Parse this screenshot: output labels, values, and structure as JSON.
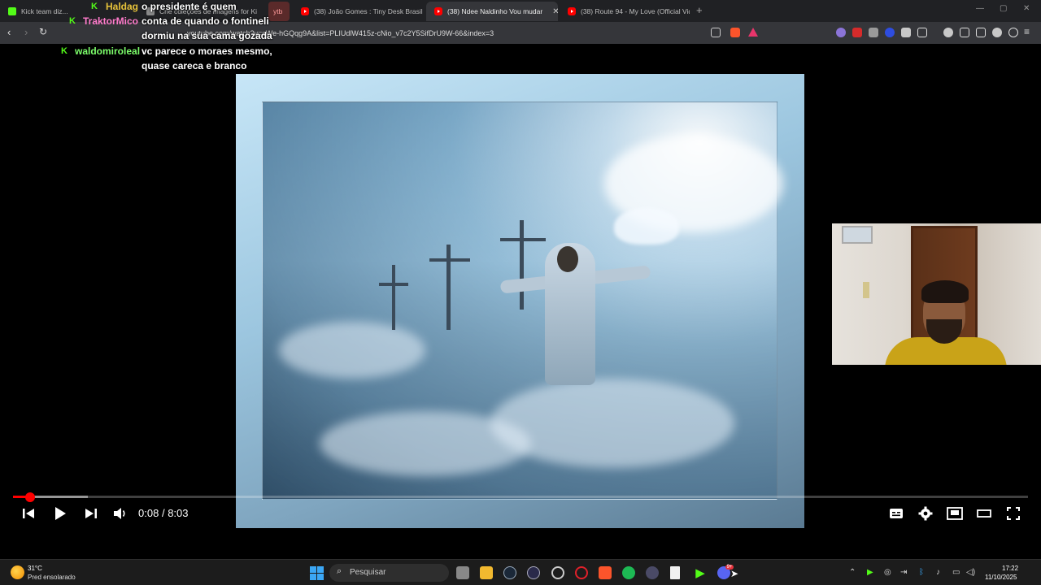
{
  "tabs": [
    {
      "label": "Kick team diz...",
      "favicon": "kick-icon",
      "active": false
    },
    {
      "label": "Crie coleções de imagens for Ki",
      "favicon": "generic-icon",
      "active": false
    },
    {
      "label": "ytb",
      "favicon": "",
      "active": false
    },
    {
      "label": "(38) João Gomes : Tiny Desk Brasil - T",
      "favicon": "youtube-icon",
      "active": false
    },
    {
      "label": "(38) Ndee Naldinho Vou mudar",
      "favicon": "youtube-icon",
      "active": true
    },
    {
      "label": "(38) Route 94 - My Love (Official Vide",
      "favicon": "youtube-icon",
      "active": false
    }
  ],
  "address": {
    "url": "youtube.com/watch?v=sWe-hGQqg9A&list=PLIUdlW415z-cNio_v7c2Y5SifDrU9W-66&index=3"
  },
  "chat": [
    {
      "user": "Haldag",
      "user_color": "#e6c23a",
      "message": "o presidente é quem"
    },
    {
      "user": "TraktorMico",
      "user_color": "#ff7bcb",
      "message": "conta de quando o fontineli"
    },
    {
      "user": "",
      "user_color": "#ffffff",
      "message": "dormiu na sua cama gozada"
    },
    {
      "user": "waldomiroleal",
      "user_color": "#7dff6b",
      "message": "vc parece o moraes mesmo,"
    },
    {
      "user": "",
      "user_color": "#ffffff",
      "message": "quase careca e branco"
    }
  ],
  "player": {
    "current_time": "0:08",
    "separator": "/",
    "duration": "8:03",
    "played_fraction": 0.017,
    "buffered_fraction": 0.074,
    "accent_color": "#ff0000"
  },
  "taskbar": {
    "weather_temp": "31°C",
    "weather_desc": "Pred ensolarado",
    "search_placeholder": "Pesquisar",
    "time": "17:22",
    "date": "11/10/2025",
    "discord_badge": "9+"
  }
}
